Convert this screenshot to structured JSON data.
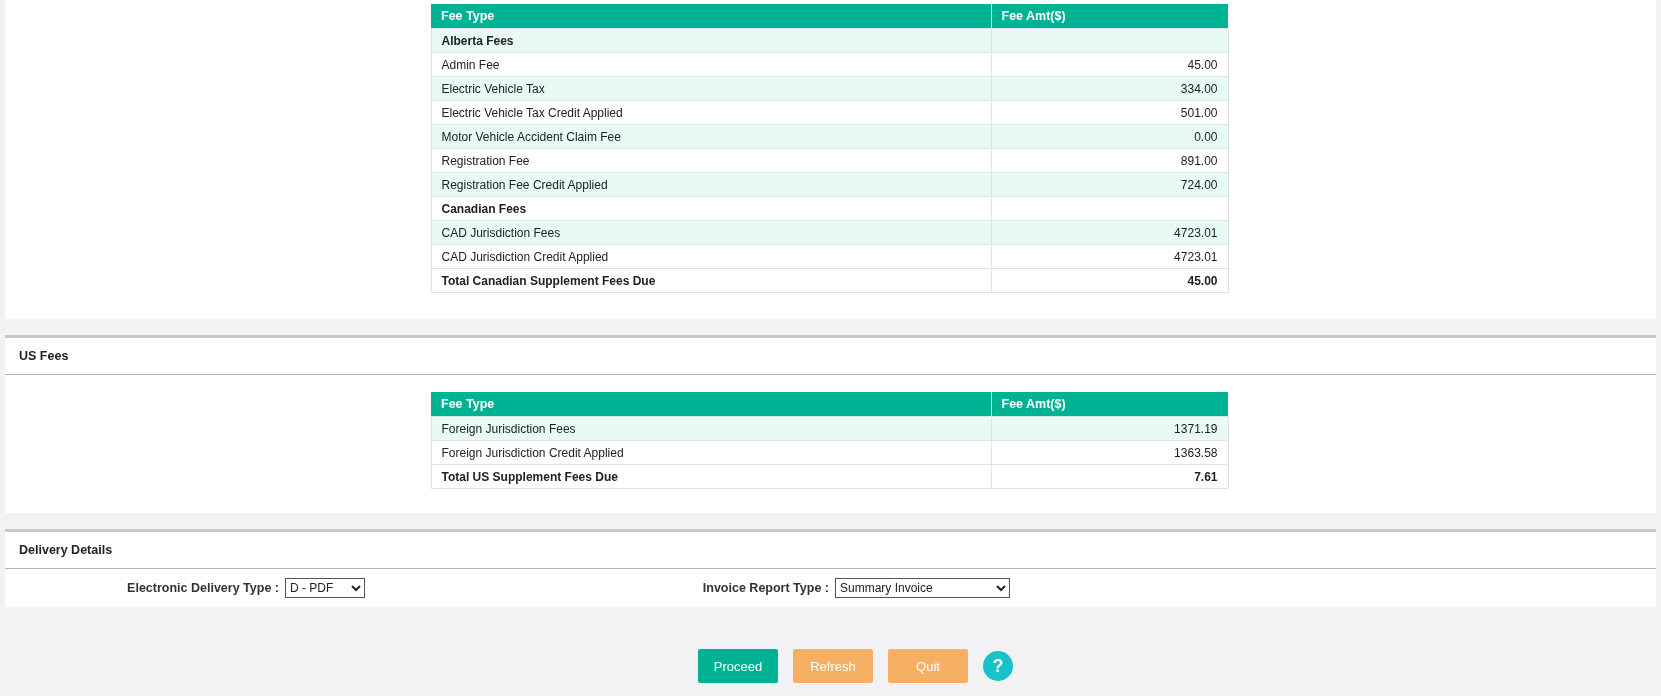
{
  "canadian_fees": {
    "table": {
      "columns": [
        "Fee Type",
        "Fee Amt($)"
      ],
      "rows": [
        {
          "kind": "group",
          "label": "Alberta Fees"
        },
        {
          "kind": "fee",
          "label": "Admin Fee",
          "amount": "45.00"
        },
        {
          "kind": "fee",
          "label": "Electric Vehicle Tax",
          "amount": "334.00"
        },
        {
          "kind": "fee",
          "label": "Electric Vehicle Tax Credit Applied",
          "amount": "501.00"
        },
        {
          "kind": "fee",
          "label": "Motor Vehicle Accident Claim Fee",
          "amount": "0.00"
        },
        {
          "kind": "fee",
          "label": "Registration Fee",
          "amount": "891.00"
        },
        {
          "kind": "fee",
          "label": "Registration Fee Credit Applied",
          "amount": "724.00"
        },
        {
          "kind": "group",
          "label": "Canadian Fees"
        },
        {
          "kind": "fee",
          "label": "CAD Jurisdiction Fees",
          "amount": "4723.01"
        },
        {
          "kind": "fee",
          "label": "CAD Jurisdiction Credit Applied",
          "amount": "4723.01"
        },
        {
          "kind": "total",
          "label": "Total Canadian Supplement Fees Due",
          "amount": "45.00"
        }
      ]
    }
  },
  "us_fees": {
    "title": "US Fees",
    "table": {
      "columns": [
        "Fee Type",
        "Fee Amt($)"
      ],
      "rows": [
        {
          "kind": "fee",
          "label": "Foreign Jurisdiction Fees",
          "amount": "1371.19"
        },
        {
          "kind": "fee",
          "label": "Foreign Jurisdiction Credit Applied",
          "amount": "1363.58"
        },
        {
          "kind": "total",
          "label": "Total US Supplement Fees Due",
          "amount": "7.61"
        }
      ]
    }
  },
  "delivery_details": {
    "title": "Delivery Details",
    "fields": [
      {
        "label": "Electronic Delivery Type :",
        "value": "D - PDF"
      },
      {
        "label": "Invoice Report Type :",
        "value": "Summary Invoice"
      }
    ]
  },
  "buttons": [
    {
      "kind": "primary",
      "label": "Proceed"
    },
    {
      "kind": "secondary",
      "label": "Refresh"
    },
    {
      "kind": "secondary",
      "label": "Quit"
    },
    {
      "kind": "help",
      "label": "?"
    }
  ]
}
